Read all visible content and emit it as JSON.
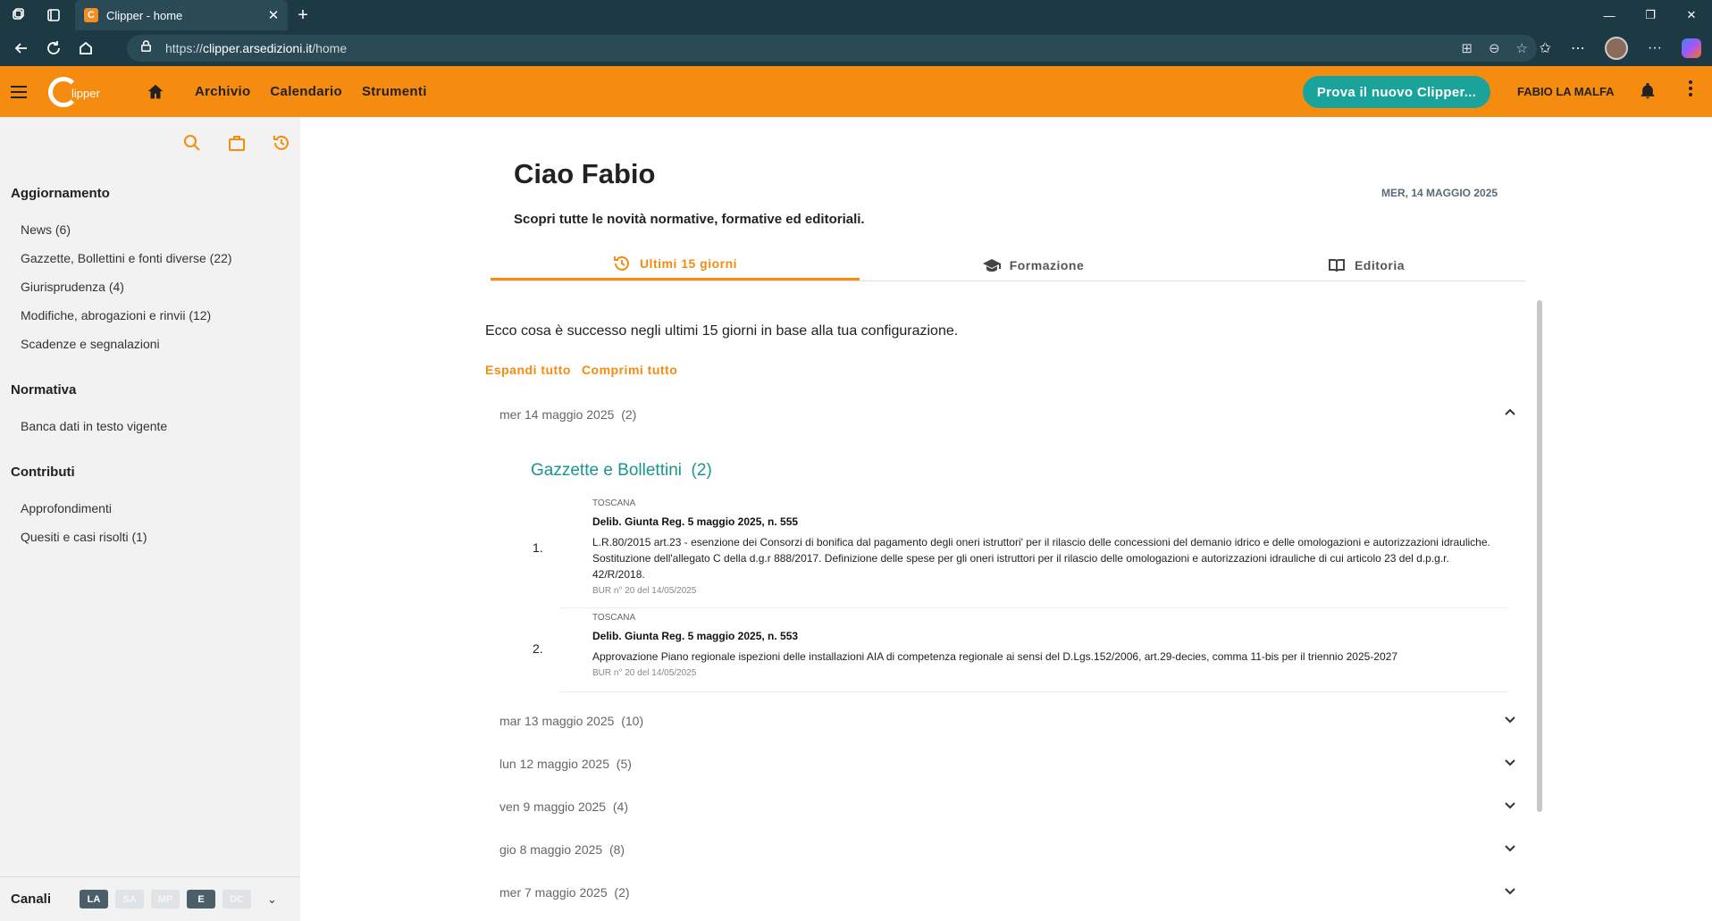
{
  "browser": {
    "tab_title": "Clipper - home",
    "url_prefix": "https://",
    "url_domain": "clipper.arsedizioni.it",
    "url_path": "/home"
  },
  "header": {
    "nav": [
      "Archivio",
      "Calendario",
      "Strumenti"
    ],
    "logo_text": "lipper",
    "prova_button": "Prova il nuovo Clipper...",
    "user": "FABIO LA MALFA"
  },
  "sidebar": {
    "sections": [
      {
        "title": "Aggiornamento",
        "items": [
          "News (6)",
          "Gazzette, Bollettini e fonti diverse (22)",
          "Giurisprudenza (4)",
          "Modifiche, abrogazioni e rinvii (12)",
          "Scadenze e segnalazioni"
        ]
      },
      {
        "title": "Normativa",
        "items": [
          "Banca dati in testo vigente"
        ]
      },
      {
        "title": "Contributi",
        "items": [
          "Approfondimenti",
          "Quesiti e casi risolti (1)"
        ]
      }
    ],
    "canali_label": "Canali",
    "canali": [
      {
        "code": "LA",
        "active": true
      },
      {
        "code": "SA",
        "active": false
      },
      {
        "code": "MP",
        "active": false
      },
      {
        "code": "E",
        "active": true
      },
      {
        "code": "DC",
        "active": false
      }
    ]
  },
  "main": {
    "greeting": "Ciao Fabio",
    "date": "MER, 14 MAGGIO 2025",
    "subtitle": "Scopri tutte le novità normative, formative ed editoriali.",
    "tabs": [
      "Ultimi 15 giorni",
      "Formazione",
      "Editoria"
    ],
    "intro": "Ecco cosa è successo negli ultimi 15 giorni in base alla tua configurazione.",
    "expand_all": "Espandi tutto",
    "collapse_all": "Comprimi tutto",
    "days": [
      {
        "label": "mer 14 maggio 2025",
        "count": "(2)"
      },
      {
        "label": "mar 13 maggio 2025",
        "count": "(10)"
      },
      {
        "label": "lun 12 maggio 2025",
        "count": "(5)"
      },
      {
        "label": "ven 9 maggio 2025",
        "count": "(4)"
      },
      {
        "label": "gio 8 maggio 2025",
        "count": "(8)"
      },
      {
        "label": "mer 7 maggio 2025",
        "count": "(2)"
      }
    ],
    "group_title": "Gazzette e Bollettini",
    "group_count": "(2)",
    "entries": [
      {
        "num": "1.",
        "region": "TOSCANA",
        "title": "Delib. Giunta Reg. 5 maggio 2025, n. 555",
        "desc": "L.R.80/2015 art.23 - esenzione dei Consorzi di bonifica dal pagamento degli oneri istruttori' per il rilascio delle concessioni del demanio idrico e delle omologazioni e autorizzazioni idrauliche. Sostituzione dell'allegato C della d.g.r 888/2017. Definizione delle spese per gli oneri istruttori per il rilascio delle omologazioni e autorizzazioni idrauliche di cui articolo 23 del d.p.g.r. 42/R/2018.",
        "bur": "BUR n° 20 del 14/05/2025"
      },
      {
        "num": "2.",
        "region": "TOSCANA",
        "title": "Delib. Giunta Reg. 5 maggio 2025, n. 553",
        "desc": "Approvazione Piano regionale ispezioni delle installazioni AIA di competenza regionale ai sensi del D.Lgs.152/2006, art.29-decies, comma 11-bis per il triennio 2025-2027",
        "bur": "BUR n° 20 del 14/05/2025"
      }
    ]
  },
  "colors": {
    "accent": "#f58c0f",
    "teal": "#1aa39b",
    "chrome": "#1d3a44"
  }
}
